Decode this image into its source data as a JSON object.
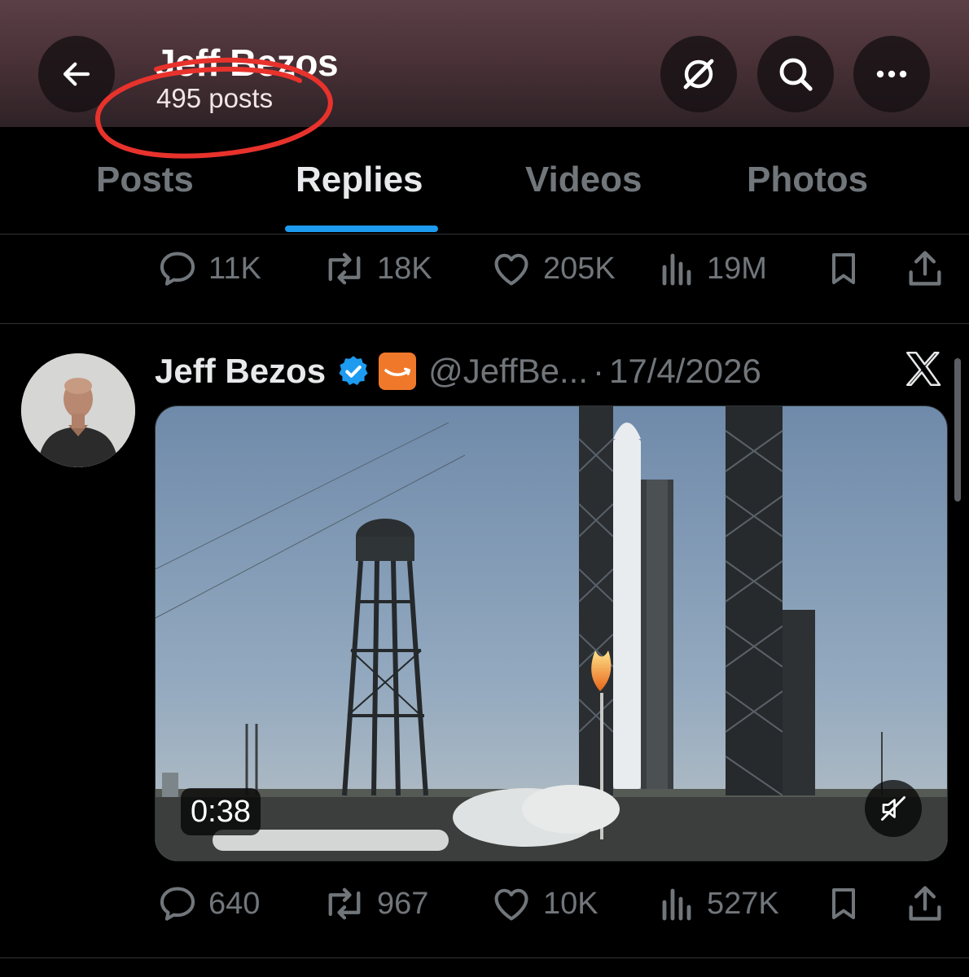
{
  "header": {
    "title": "Jeff Bezos",
    "post_count": "495 posts",
    "icons": [
      "back-arrow-icon",
      "grok-icon",
      "search-icon",
      "more-icon"
    ]
  },
  "tabs": [
    {
      "label": "Posts",
      "active": false
    },
    {
      "label": "Replies",
      "active": true
    },
    {
      "label": "Videos",
      "active": false
    },
    {
      "label": "Photos",
      "active": false
    }
  ],
  "previous_post": {
    "replies": "11K",
    "reposts": "18K",
    "likes": "205K",
    "views": "19M"
  },
  "tweet": {
    "author_name": "Jeff Bezos",
    "handle": "@JeffBe...",
    "separator": "·",
    "date": "17/4/2026",
    "video_duration": "0:38",
    "replies": "640",
    "reposts": "967",
    "likes": "10K",
    "views": "527K"
  },
  "colors": {
    "accent": "#1d9bf0",
    "annotation": "#e8322c",
    "muted_text": "#71767b",
    "amazon_orange": "#f0782a"
  }
}
